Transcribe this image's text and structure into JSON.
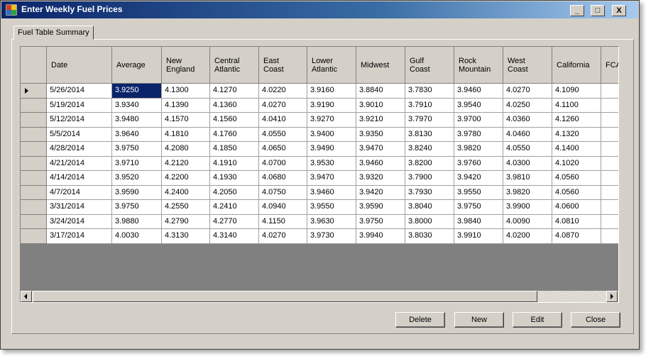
{
  "window": {
    "title": "Enter Weekly Fuel Prices"
  },
  "window_controls": {
    "minimize": "_",
    "maximize": "□",
    "close": "X"
  },
  "tabs": [
    {
      "label": "Fuel Table Summary"
    }
  ],
  "table": {
    "columns": [
      "Date",
      "Average",
      "New England",
      "Central Atlantic",
      "East Coast",
      "Lower Atlantic",
      "Midwest",
      "Gulf Coast",
      "Rock Mountain",
      "West Coast",
      "California",
      "FCA"
    ],
    "header_lines": [
      [
        "Date"
      ],
      [
        "Average"
      ],
      [
        "New",
        "England"
      ],
      [
        "Central",
        "Atlantic"
      ],
      [
        "East",
        "Coast"
      ],
      [
        "Lower",
        "Atlantic"
      ],
      [
        "Midwest"
      ],
      [
        "Gulf",
        "Coast"
      ],
      [
        "Rock",
        "Mountain"
      ],
      [
        "West",
        "Coast"
      ],
      [
        "California"
      ],
      [
        "FCA"
      ]
    ],
    "rows": [
      [
        "5/26/2014",
        "3.9250",
        "4.1300",
        "4.1270",
        "4.0220",
        "3.9160",
        "3.8840",
        "3.7830",
        "3.9460",
        "4.0270",
        "4.1090",
        ""
      ],
      [
        "5/19/2014",
        "3.9340",
        "4.1390",
        "4.1360",
        "4.0270",
        "3.9190",
        "3.9010",
        "3.7910",
        "3.9540",
        "4.0250",
        "4.1100",
        ""
      ],
      [
        "5/12/2014",
        "3.9480",
        "4.1570",
        "4.1560",
        "4.0410",
        "3.9270",
        "3.9210",
        "3.7970",
        "3.9700",
        "4.0360",
        "4.1260",
        ""
      ],
      [
        "5/5/2014",
        "3.9640",
        "4.1810",
        "4.1760",
        "4.0550",
        "3.9400",
        "3.9350",
        "3.8130",
        "3.9780",
        "4.0460",
        "4.1320",
        ""
      ],
      [
        "4/28/2014",
        "3.9750",
        "4.2080",
        "4.1850",
        "4.0650",
        "3.9490",
        "3.9470",
        "3.8240",
        "3.9820",
        "4.0550",
        "4.1400",
        ""
      ],
      [
        "4/21/2014",
        "3.9710",
        "4.2120",
        "4.1910",
        "4.0700",
        "3.9530",
        "3.9460",
        "3.8200",
        "3.9760",
        "4.0300",
        "4.1020",
        ""
      ],
      [
        "4/14/2014",
        "3.9520",
        "4.2200",
        "4.1930",
        "4.0680",
        "3.9470",
        "3.9320",
        "3.7900",
        "3.9420",
        "3.9810",
        "4.0560",
        ""
      ],
      [
        "4/7/2014",
        "3.9590",
        "4.2400",
        "4.2050",
        "4.0750",
        "3.9460",
        "3.9420",
        "3.7930",
        "3.9550",
        "3.9820",
        "4.0560",
        ""
      ],
      [
        "3/31/2014",
        "3.9750",
        "4.2550",
        "4.2410",
        "4.0940",
        "3.9550",
        "3.9590",
        "3.8040",
        "3.9750",
        "3.9900",
        "4.0600",
        ""
      ],
      [
        "3/24/2014",
        "3.9880",
        "4.2790",
        "4.2770",
        "4.1150",
        "3.9630",
        "3.9750",
        "3.8000",
        "3.9840",
        "4.0090",
        "4.0810",
        ""
      ],
      [
        "3/17/2014",
        "4.0030",
        "4.3130",
        "4.3140",
        "4.0270",
        "3.9730",
        "3.9940",
        "3.8030",
        "3.9910",
        "4.0200",
        "4.0870",
        ""
      ]
    ],
    "selected_row": 0,
    "current_row_icon": "current-row-arrow-icon"
  },
  "buttons": {
    "delete": "Delete",
    "new": "New",
    "edit": "Edit",
    "close": "Close"
  },
  "colors": {
    "title_bar": "#0a246a",
    "selection": "#0a246a",
    "grid_background": "#808080",
    "window_face": "#d4d0c8"
  }
}
